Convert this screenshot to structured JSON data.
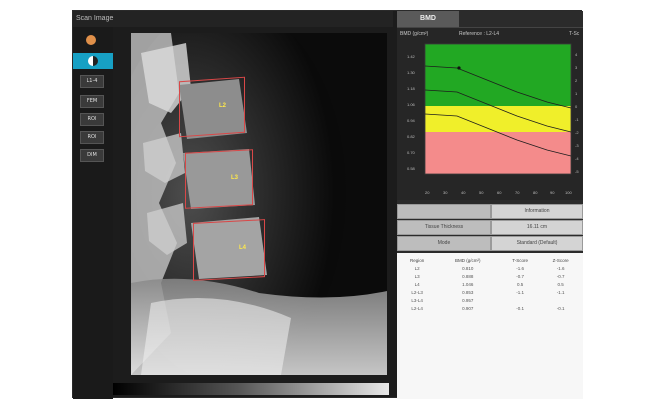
{
  "window": {
    "title": "Scan Image"
  },
  "tools": [
    {
      "name": "tool-orange-dot",
      "label": ""
    },
    {
      "name": "tool-spine-selected",
      "label": ""
    },
    {
      "name": "tool-l1-l4",
      "label": "L1-4"
    },
    {
      "name": "tool-fem",
      "label": "FEM"
    },
    {
      "name": "tool-roi",
      "label": "ROI"
    },
    {
      "name": "tool-roi2",
      "label": "ROI"
    },
    {
      "name": "tool-dim",
      "label": "DIM"
    }
  ],
  "rois": [
    {
      "label": "L2"
    },
    {
      "label": "L3"
    },
    {
      "label": "L4"
    }
  ],
  "panel": {
    "tab_label": "BMD",
    "graph": {
      "ylabel": "BMD (g/cm²)",
      "reference": "Reference : L2-L4",
      "right_label": "T-Sc",
      "yticks": [
        "1.42",
        "1.30",
        "1.18",
        "1.06",
        "0.94",
        "0.82",
        "0.70",
        "0.58"
      ],
      "yticks_right": [
        "4",
        "3",
        "2",
        "1",
        "0",
        "-1",
        "-2",
        "-3",
        "-4",
        "-5"
      ],
      "xticks": [
        "20",
        "30",
        "40",
        "50",
        "60",
        "70",
        "80",
        "90",
        "100"
      ]
    },
    "buttons": {
      "row1_right": "Information",
      "tissue_thickness": "Tissue Thickness",
      "thickness_value": "16.11 cm",
      "mode": "Mode",
      "mode_value": "Standard (Default)"
    },
    "table": {
      "headers": [
        "Region",
        "BMD (g/cm²)",
        "T-Score",
        "Z-Score"
      ],
      "rows": [
        [
          "L2",
          "0.810",
          "-1.6",
          "-1.6"
        ],
        [
          "L3",
          "0.888",
          "-0.7",
          "-0.7"
        ],
        [
          "L4",
          "1.046",
          "0.5",
          "0.5"
        ],
        [
          "L2-L3",
          "0.853",
          "-1.1",
          "-1.1"
        ],
        [
          "L3-L4",
          "0.957",
          "",
          ""
        ],
        [
          "L2-L4",
          "0.907",
          "-0.1",
          "-0.1"
        ]
      ]
    }
  },
  "colors": {
    "accent": "#17a0c4",
    "zone_normal": "#22a823",
    "zone_osteopenia": "#f0ef2a",
    "zone_osteoporosis": "#f48b8b",
    "roi_outline": "#d94848",
    "roi_label": "#ffe94a"
  }
}
